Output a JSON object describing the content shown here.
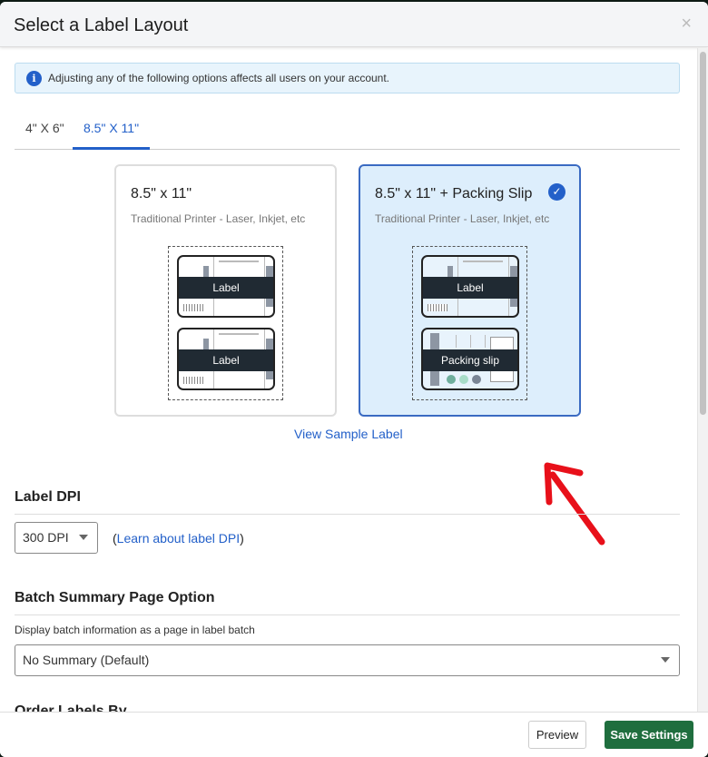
{
  "modal": {
    "title": "Select a Label Layout",
    "close_icon": "close-icon"
  },
  "notice": {
    "icon": "info-icon",
    "text": "Adjusting any of the following options affects all users on your account.",
    "color": "#2360c9"
  },
  "tabs": [
    {
      "label": "4\" X 6\"",
      "active": false
    },
    {
      "label": "8.5\" X 11\"",
      "active": true
    }
  ],
  "layouts": [
    {
      "title": "8.5\" x 11\"",
      "subtitle": "Traditional Printer - Laser, Inkjet, etc",
      "selected": false,
      "parts": [
        "Label",
        "Label"
      ]
    },
    {
      "title": "8.5\" x 11\" + Packing Slip",
      "subtitle": "Traditional Printer - Laser, Inkjet, etc",
      "selected": true,
      "parts": [
        "Label",
        "Packing slip"
      ]
    }
  ],
  "view_sample": "View Sample Label",
  "dpi": {
    "heading": "Label DPI",
    "value": "300 DPI",
    "paren_open": "(",
    "link": "Learn about label DPI",
    "paren_close": ")"
  },
  "batch": {
    "heading": "Batch Summary Page Option",
    "description": "Display batch information as a page in label batch",
    "value": "No Summary (Default)"
  },
  "next_heading": "Order Labels By",
  "footer": {
    "preview": "Preview",
    "save": "Save Settings",
    "save_color": "#1f6e3e"
  },
  "annotation": {
    "arrow_color": "#e8101a"
  }
}
